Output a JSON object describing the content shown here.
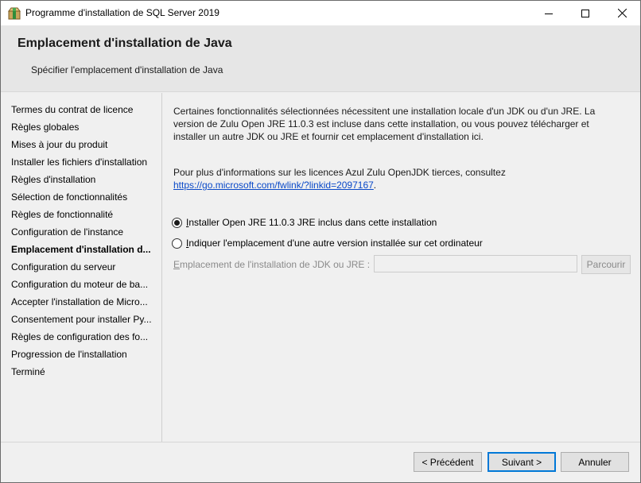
{
  "window": {
    "title": "Programme d'installation de SQL Server 2019"
  },
  "header": {
    "title": "Emplacement d'installation de Java",
    "subtitle": "Spécifier l'emplacement d'installation de Java"
  },
  "nav": {
    "items": [
      {
        "label": "Termes du contrat de licence"
      },
      {
        "label": "Règles globales"
      },
      {
        "label": "Mises à jour du produit"
      },
      {
        "label": "Installer les fichiers d'installation"
      },
      {
        "label": "Règles d'installation"
      },
      {
        "label": "Sélection de fonctionnalités"
      },
      {
        "label": "Règles de fonctionnalité"
      },
      {
        "label": "Configuration de l'instance"
      },
      {
        "label": "Emplacement d'installation d..."
      },
      {
        "label": "Configuration du serveur"
      },
      {
        "label": "Configuration du moteur de ba..."
      },
      {
        "label": "Accepter l'installation de Micro..."
      },
      {
        "label": "Consentement pour installer Py..."
      },
      {
        "label": "Règles de configuration des fo..."
      },
      {
        "label": "Progression de l'installation"
      },
      {
        "label": "Terminé"
      }
    ],
    "active_index": 8
  },
  "content": {
    "intro_line1": "Certaines fonctionnalités sélectionnées nécessitent une installation locale d'un JDK ou d'un JRE. La",
    "intro_line2": "version de Zulu Open JRE 11.0.3 est incluse dans cette installation, ou vous pouvez télécharger et",
    "intro_line3": "installer un autre JDK ou JRE et fournir cet emplacement d'installation ici.",
    "license_text": "Pour plus d'informations sur les licences Azul Zulu OpenJDK tierces, consultez",
    "license_link": "https://go.microsoft.com/fwlink/?linkid=2097167",
    "license_link_suffix": ".",
    "option_included": "Installer Open JRE 11.0.3 JRE inclus dans cette installation",
    "option_other": "Indiquer l'emplacement d'une autre version installée sur cet ordinateur",
    "path_label": "Emplacement de l'installation de JDK ou JRE :",
    "path_value": "",
    "browse_label": "Parcourir"
  },
  "footer": {
    "prev_label": "< Précédent",
    "next_label": "Suivant >",
    "cancel_label": "Annuler"
  }
}
